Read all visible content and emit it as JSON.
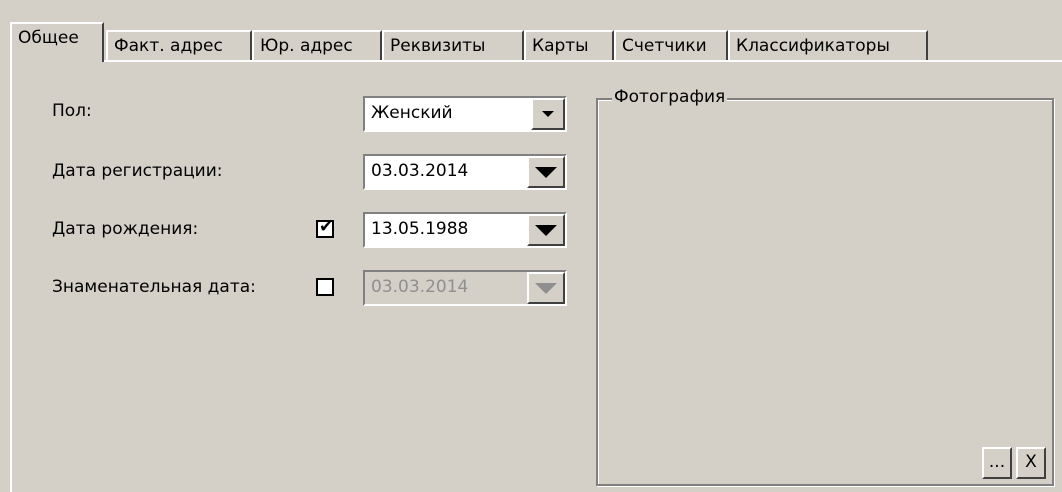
{
  "tabs": [
    {
      "label": "Общее"
    },
    {
      "label": "Факт. адрес"
    },
    {
      "label": "Юр. адрес"
    },
    {
      "label": "Реквизиты"
    },
    {
      "label": "Карты"
    },
    {
      "label": "Счетчики"
    },
    {
      "label": "Классификаторы"
    }
  ],
  "form": {
    "gender": {
      "label": "Пол:",
      "value": "Женский"
    },
    "registration_date": {
      "label": "Дата регистрации:",
      "value": "03.03.2014"
    },
    "birth_date": {
      "label": "Дата рождения:",
      "value": "13.05.1988",
      "checked": true
    },
    "significant_date": {
      "label": "Знаменательная дата:",
      "value": "03.03.2014",
      "checked": false
    }
  },
  "photo": {
    "title": "Фотография",
    "browse_label": "...",
    "clear_label": "X"
  },
  "check_mark": "✔"
}
